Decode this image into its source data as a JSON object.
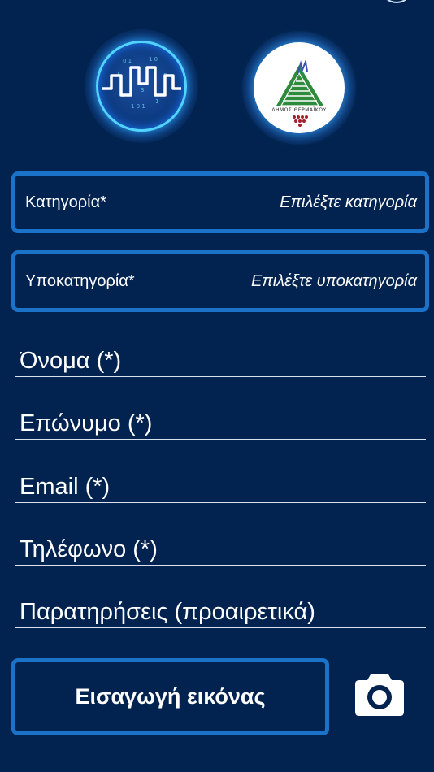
{
  "category": {
    "label": "Κατηγορία*",
    "value": "Επιλέξτε κατηγορία"
  },
  "subcategory": {
    "label": "Υποκατηγορία*",
    "value": "Επιλέξτε υποκατηγορία"
  },
  "fields": {
    "first_name": "Όνομα (*)",
    "last_name": "Επώνυμο (*)",
    "email": "Email (*)",
    "phone": "Τηλέφωνο (*)",
    "notes": "Παρατηρήσεις (προαιρετικά)"
  },
  "actions": {
    "insert_image": "Εισαγωγή εικόνας"
  },
  "logos": {
    "municipality_text": "ΔΗΜΟΣ ΘΕΡΜΑΪΚΟΥ"
  },
  "icons": {
    "camera": "camera-icon"
  },
  "colors": {
    "background": "#02234f",
    "accent": "#1a73c9"
  }
}
